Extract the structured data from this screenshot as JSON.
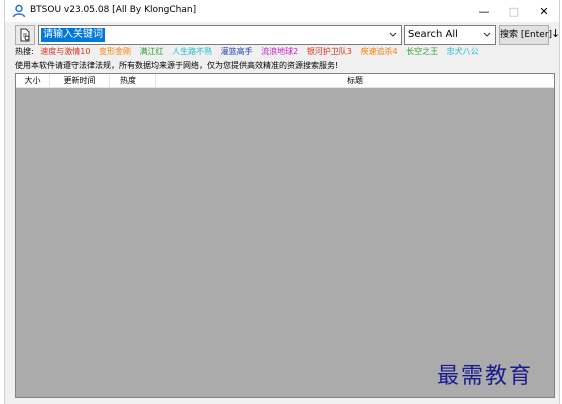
{
  "window": {
    "title": "BTSOU v23.05.08 [All By KlongChan]",
    "controls": {
      "minimize": "—",
      "maximize": "□",
      "close": "✕"
    }
  },
  "toolbar": {
    "search_value": "请输入关键词",
    "mode_selected": "Search All",
    "search_button": "搜索 [Enter]",
    "sort_arrow": "↓"
  },
  "hot": {
    "label": "热搜:",
    "items": [
      {
        "text": "速度与激情10",
        "color": "#e0301e"
      },
      {
        "text": "变形金刚",
        "color": "#ff7f00"
      },
      {
        "text": "满江红",
        "color": "#2ca02c"
      },
      {
        "text": "人生路不熟",
        "color": "#17becf"
      },
      {
        "text": "灌篮高手",
        "color": "#1f3fbf"
      },
      {
        "text": "流浪地球2",
        "color": "#c71ec7"
      },
      {
        "text": "银河护卫队3",
        "color": "#e0301e"
      },
      {
        "text": "疾速追杀4",
        "color": "#ff7f00"
      },
      {
        "text": "长空之王",
        "color": "#2ca02c"
      },
      {
        "text": "忠犬八公",
        "color": "#17becf"
      }
    ]
  },
  "notice": "使用本软件请遵守法律法规，所有数据均来源于网络，仅为您提供高效精准的资源搜索服务!",
  "table": {
    "columns": [
      "大小",
      "更新时间",
      "热度",
      "标题"
    ]
  },
  "watermark": "最需教育"
}
